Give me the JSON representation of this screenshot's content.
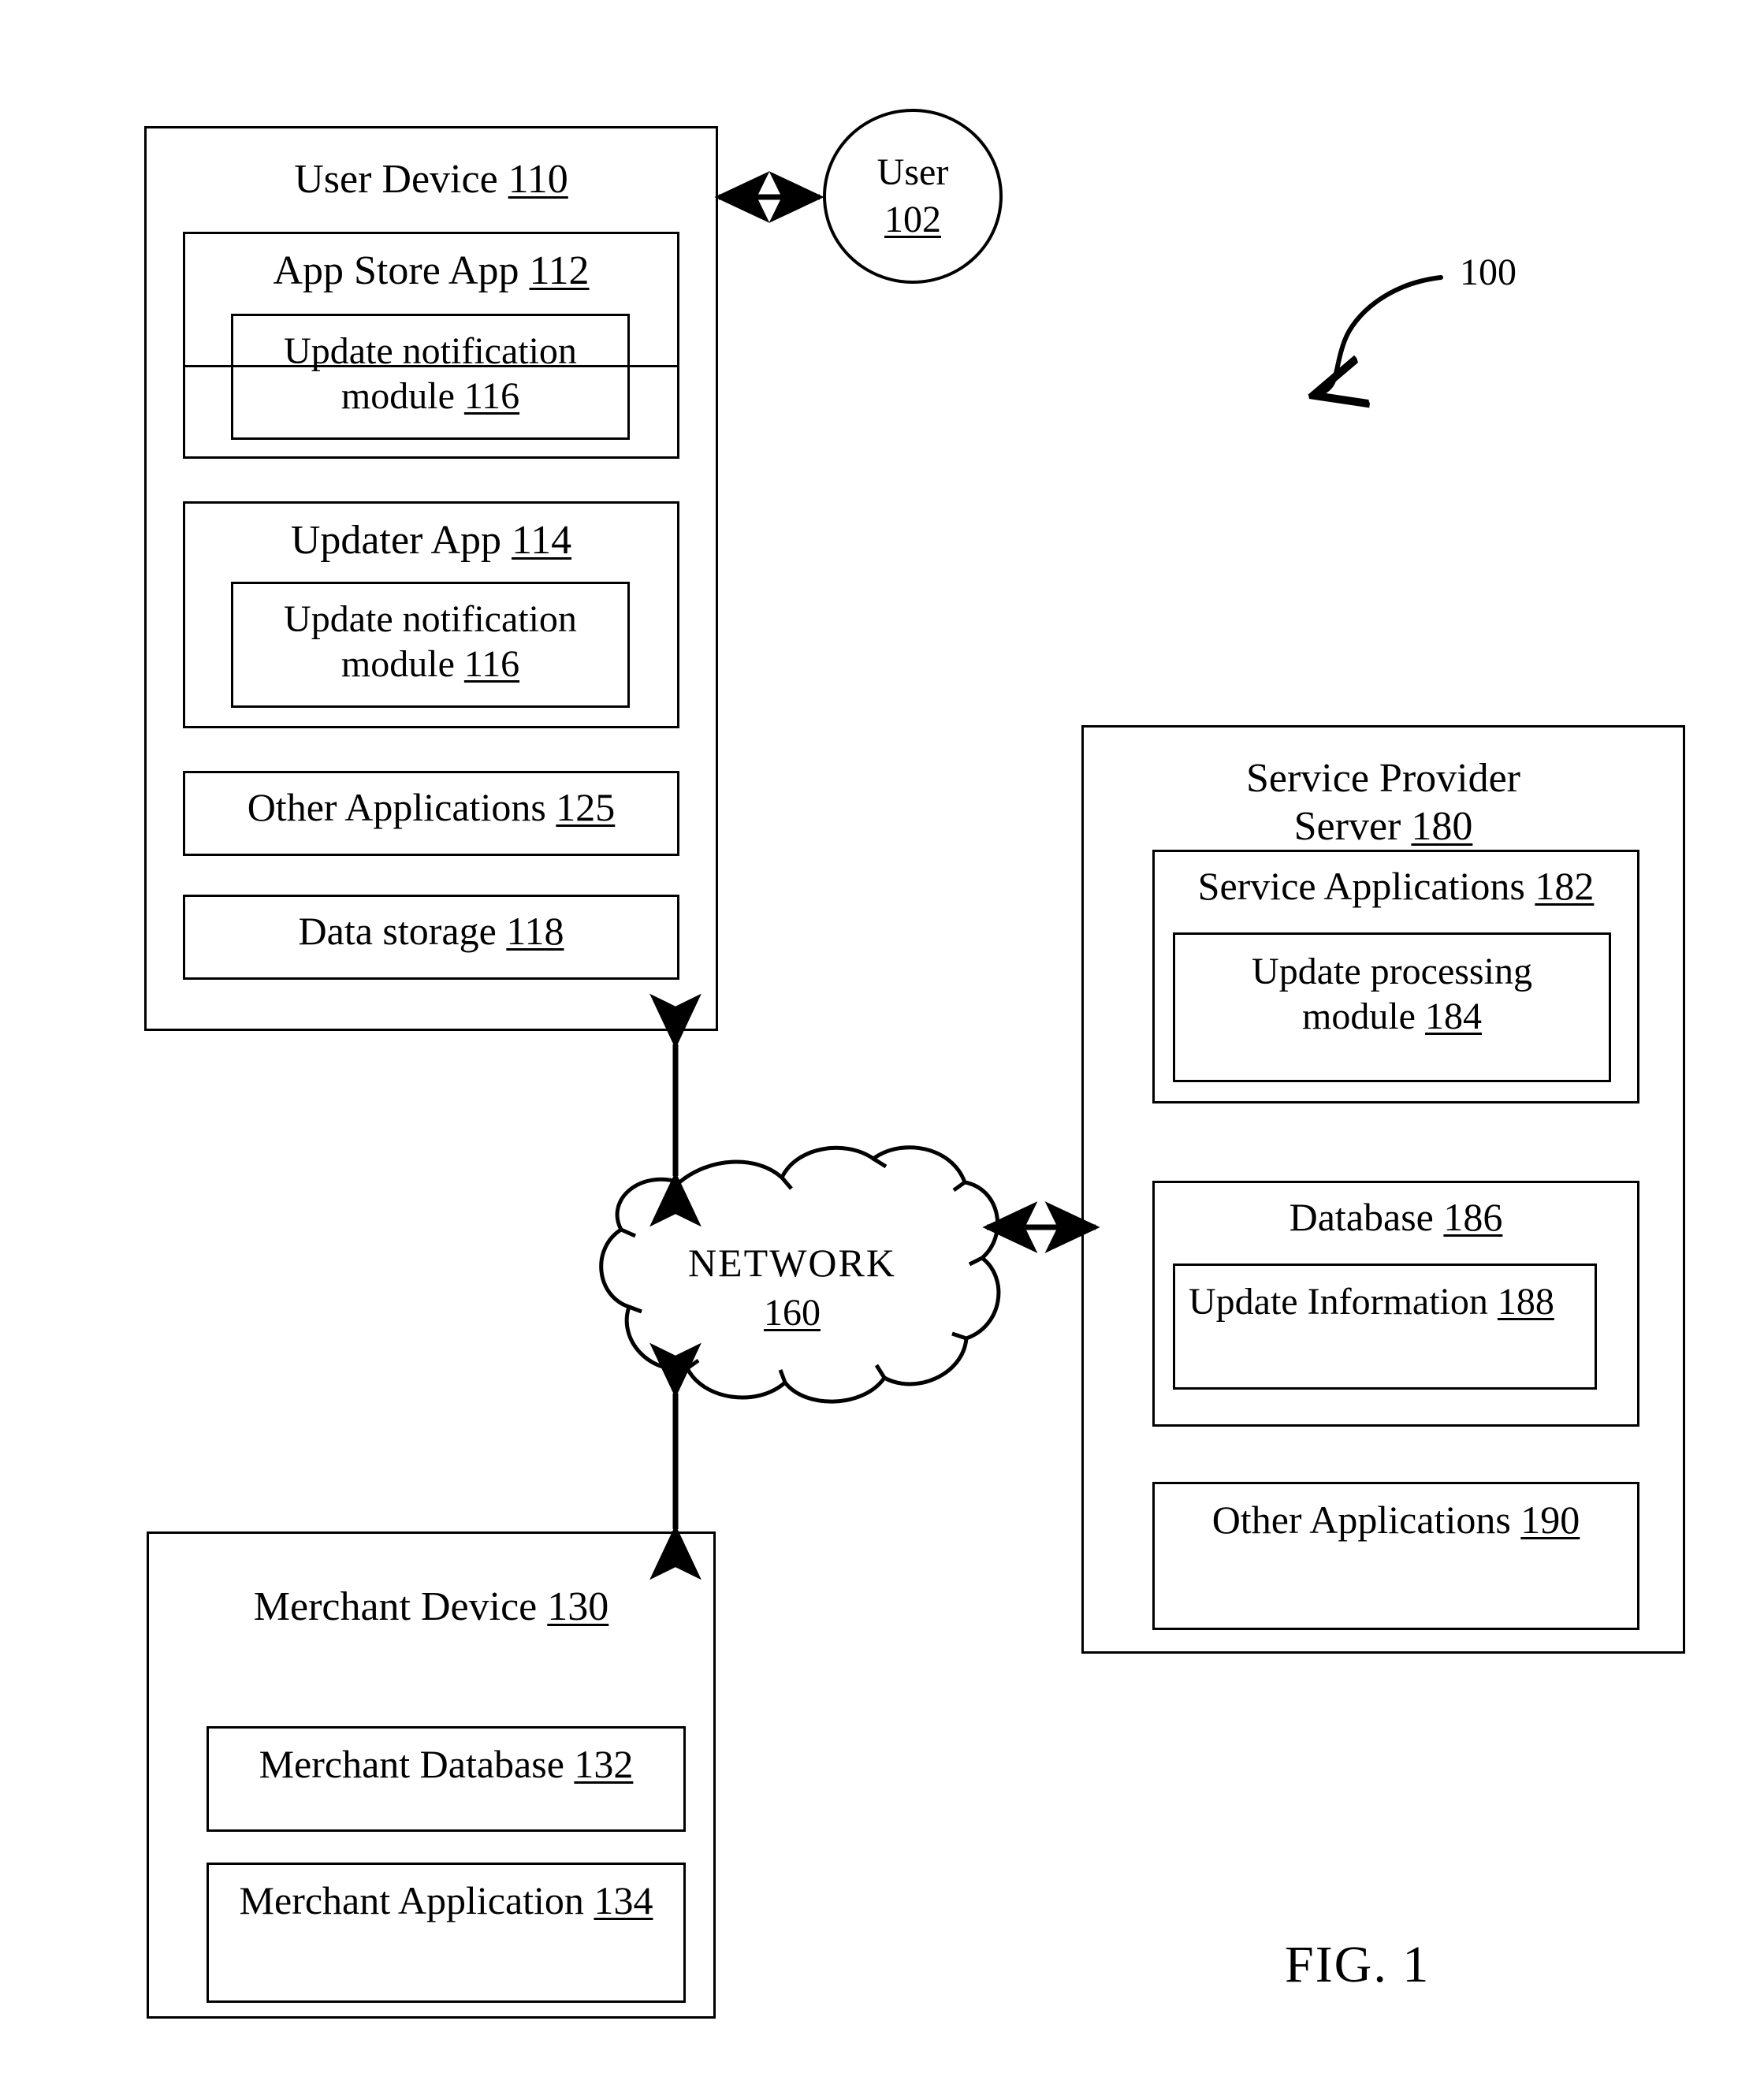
{
  "figure": {
    "caption": "FIG. 1",
    "system_reference": "100"
  },
  "user_actor": {
    "name": "User",
    "ref": "102"
  },
  "user_device": {
    "title": "User Device",
    "ref": "110",
    "app_store_app": {
      "title": "App Store App",
      "ref": "112",
      "module": {
        "title": "Update notification\nmodule",
        "ref": "116"
      }
    },
    "updater_app": {
      "title": "Updater App",
      "ref": "114",
      "module": {
        "title": "Update notification\nmodule",
        "ref": "116"
      }
    },
    "other_applications": {
      "title": "Other Applications",
      "ref": "125"
    },
    "data_storage": {
      "title": "Data storage",
      "ref": "118"
    }
  },
  "network": {
    "title": "NETWORK",
    "ref": "160"
  },
  "merchant_device": {
    "title": "Merchant Device",
    "ref": "130",
    "merchant_database": {
      "title": "Merchant Database",
      "ref": "132"
    },
    "merchant_application": {
      "title": "Merchant Application",
      "ref": "134"
    }
  },
  "service_provider_server": {
    "title": "Service Provider\nServer",
    "ref": "180",
    "service_applications": {
      "title": "Service Applications",
      "ref": "182",
      "module": {
        "title": "Update processing\nmodule",
        "ref": "184"
      }
    },
    "database": {
      "title": "Database",
      "ref": "186",
      "update_information": {
        "title": "Update Information",
        "ref": "188"
      }
    },
    "other_applications": {
      "title": "Other Applications",
      "ref": "190"
    }
  },
  "colors": {
    "ink": "#000000",
    "paper": "#ffffff"
  }
}
